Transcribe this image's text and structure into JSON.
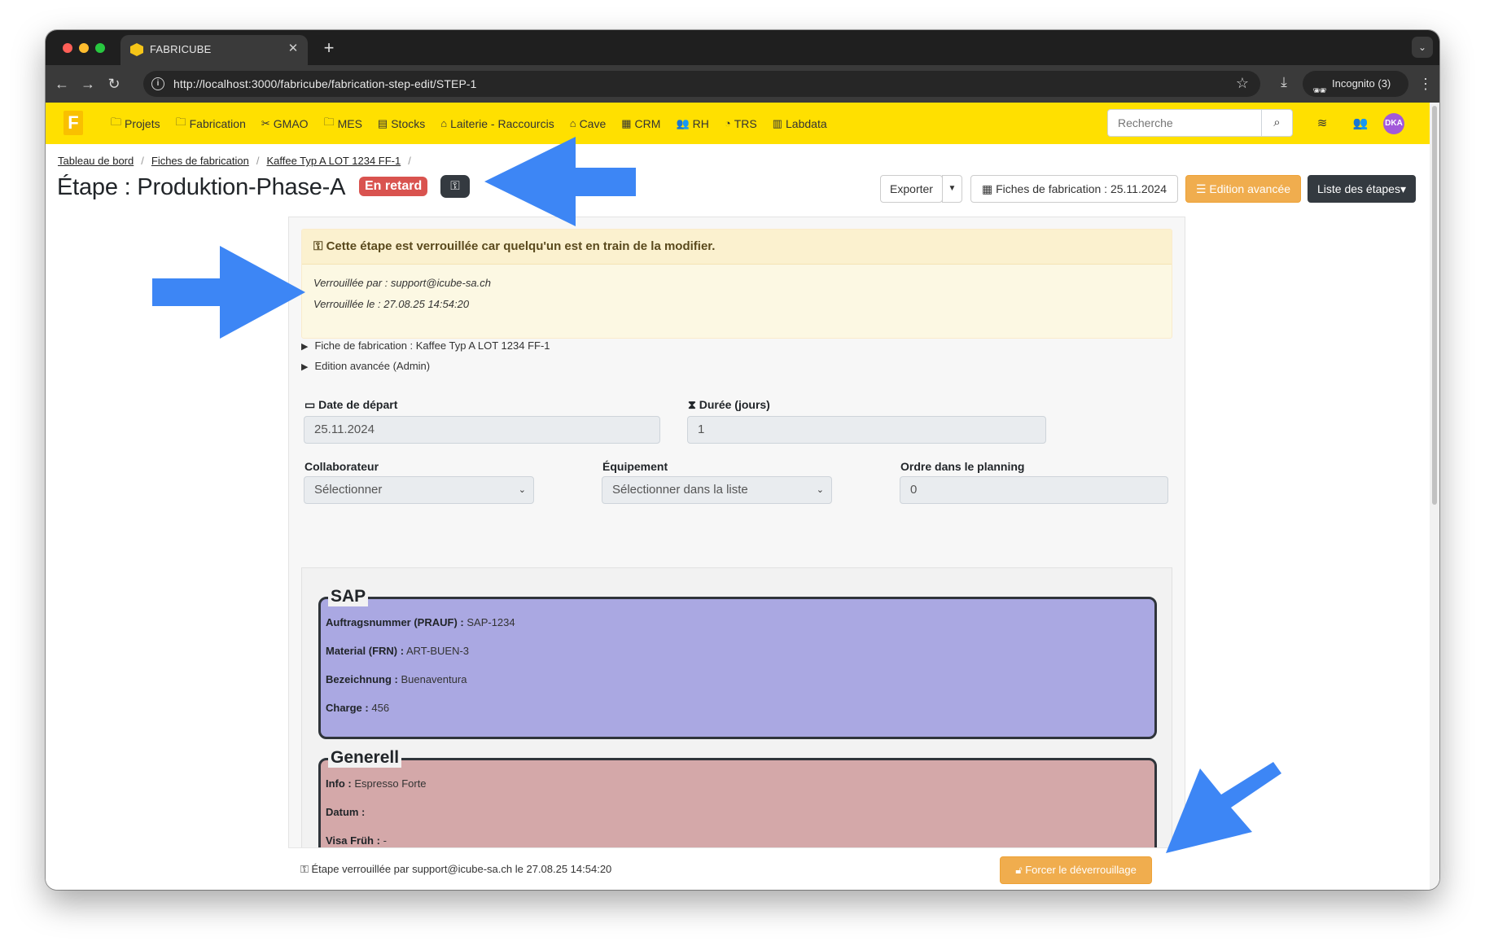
{
  "browser": {
    "tab_title": "FABRICUBE",
    "url": "http://localhost:3000/fabricube/fabrication-step-edit/STEP-1",
    "incognito_label": "Incognito (3)"
  },
  "navbar": {
    "brand": "F",
    "items": [
      {
        "label": "Projets",
        "icon": "folder-icon"
      },
      {
        "label": "Fabrication",
        "icon": "folder-icon"
      },
      {
        "label": "GMAO",
        "icon": "tools-icon"
      },
      {
        "label": "MES",
        "icon": "folder-icon"
      },
      {
        "label": "Stocks",
        "icon": "warehouse-icon"
      },
      {
        "label": "Laiterie - Raccourcis",
        "icon": "milk-icon"
      },
      {
        "label": "Cave",
        "icon": "cave-icon"
      },
      {
        "label": "CRM",
        "icon": "building-icon"
      },
      {
        "label": "RH",
        "icon": "users-icon"
      },
      {
        "label": "TRS",
        "icon": "gauge-icon"
      },
      {
        "label": "Labdata",
        "icon": "chart-icon"
      }
    ],
    "search_placeholder": "Recherche",
    "avatar": "DKA"
  },
  "breadcrumb": [
    "Tableau de bord",
    "Fiches de fabrication",
    "Kaffee Typ A LOT 1234 FF-1"
  ],
  "header": {
    "title": "Étape : Produktion-Phase-A",
    "status_badge": "En retard",
    "buttons": {
      "export": "Exporter",
      "fiches": "Fiches de fabrication : 25.11.2024",
      "edition": "Edition avancée",
      "liste": "Liste des étapes"
    }
  },
  "lock_alert": {
    "title": "Cette étape est verrouillée car quelqu'un est en train de la modifier.",
    "locked_by": "Verrouillée par : support@icube-sa.ch",
    "locked_at": "Verrouillée le : 27.08.25 14:54:20"
  },
  "collapsibles": [
    "Fiche de fabrication : Kaffee Typ A LOT 1234 FF-1",
    "Edition avancée (Admin)"
  ],
  "form": {
    "date_label": "Date de départ",
    "date_value": "25.11.2024",
    "duration_label": "Durée (jours)",
    "duration_value": "1",
    "collaborator_label": "Collaborateur",
    "collaborator_value": "Sélectionner",
    "equipment_label": "Équipement",
    "equipment_value": "Sélectionner dans la liste",
    "order_label": "Ordre dans le planning",
    "order_value": "0"
  },
  "sap": {
    "legend": "SAP",
    "rows": [
      {
        "label": "Auftragsnummer (PRAUF) :",
        "value": "SAP-1234"
      },
      {
        "label": "Material (FRN) :",
        "value": "ART-BUEN-3"
      },
      {
        "label": "Bezeichnung :",
        "value": "Buenaventura"
      },
      {
        "label": "Charge :",
        "value": "456"
      }
    ]
  },
  "generell": {
    "legend": "Generell",
    "rows": [
      {
        "label": "Info :",
        "value": "Espresso Forte"
      },
      {
        "label": "Datum :",
        "value": ""
      },
      {
        "label": "Visa Früh :",
        "value": "-"
      }
    ]
  },
  "footer": {
    "text": "Étape verrouillée par support@icube-sa.ch le 27.08.25 14:54:20",
    "force_unlock": "Forcer le déverrouillage"
  },
  "colors": {
    "navbar": "#ffe000",
    "badge_late": "#d9534f",
    "warning_button": "#f0ad4e",
    "sap_fieldset": "#aaa8e2",
    "generell_fieldset": "#d4a8a9",
    "annotation_arrow": "#3d86f5"
  }
}
